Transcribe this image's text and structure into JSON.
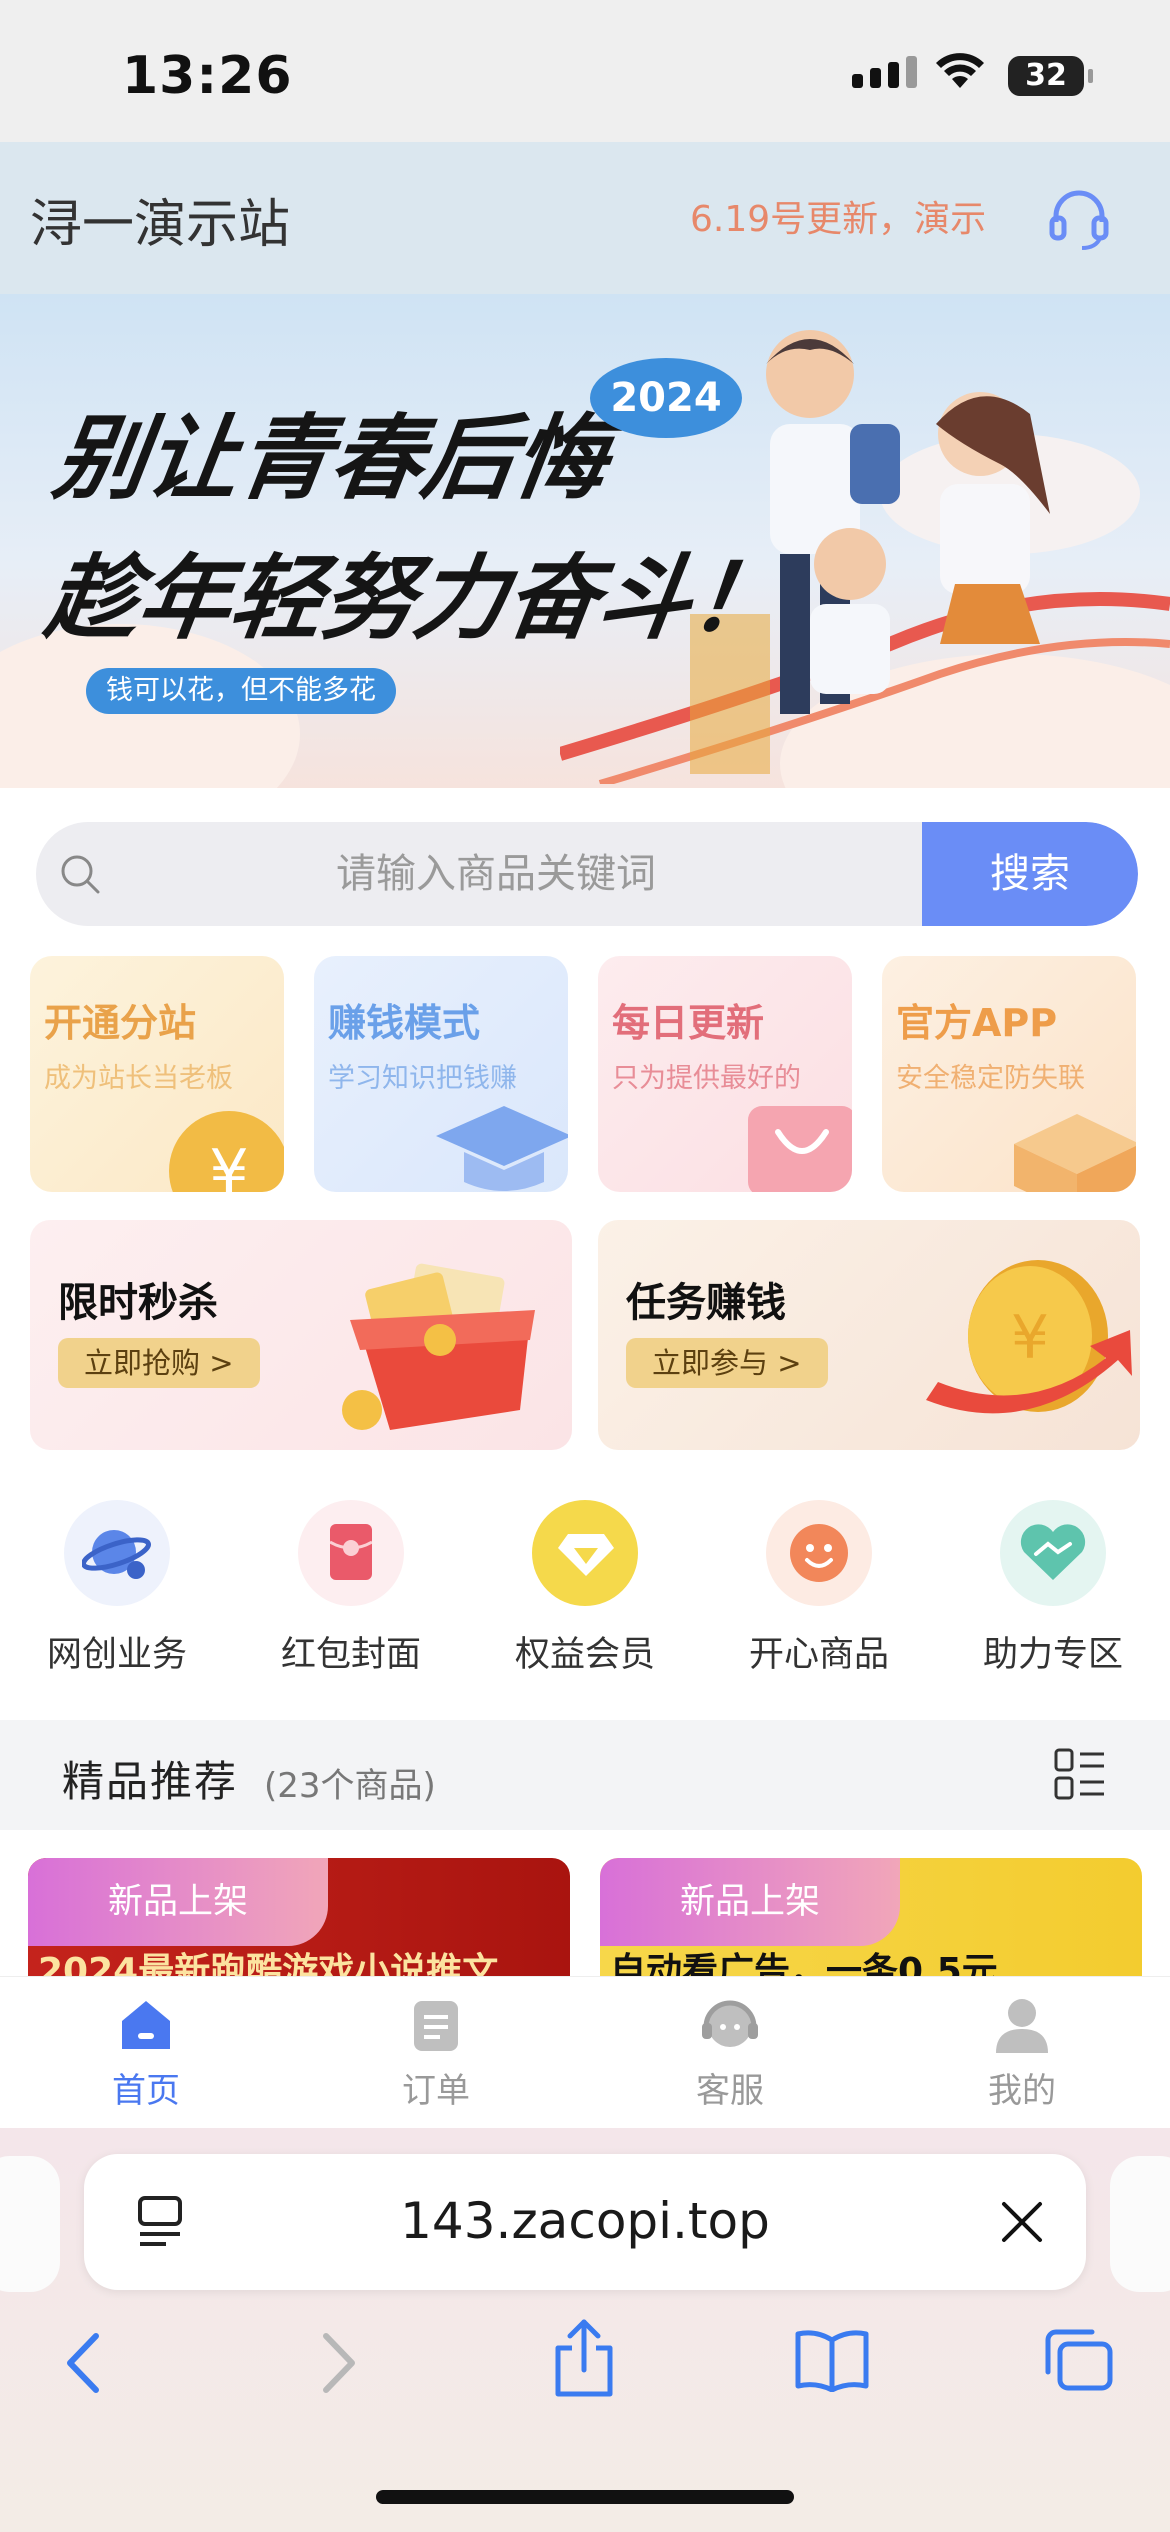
{
  "status": {
    "time": "13:26",
    "battery": "32"
  },
  "header": {
    "title": "浔一演示站",
    "notice": "6.19号更新，演示"
  },
  "banner": {
    "line1": "别让青春后悔",
    "line2": "趁年轻努力奋斗！",
    "year": "2024",
    "tagline": "钱可以花，但不能多花"
  },
  "search": {
    "placeholder": "请输入商品关键词",
    "button": "搜索"
  },
  "features": [
    {
      "title": "开通分站",
      "subtitle": "成为站长当老板",
      "color": "#e9a24a"
    },
    {
      "title": "赚钱模式",
      "subtitle": "学习知识把钱赚",
      "color": "#6aa0e9"
    },
    {
      "title": "每日更新",
      "subtitle": "只为提供最好的",
      "color": "#e26e7a"
    },
    {
      "title": "官方APP",
      "subtitle": "安全稳定防失联",
      "color": "#ee9d4a"
    }
  ],
  "promos": [
    {
      "title": "限时秒杀",
      "button": "立即抢购 >"
    },
    {
      "title": "任务赚钱",
      "button": "立即参与 >"
    }
  ],
  "quick": [
    {
      "label": "网创业务",
      "icon": "planet-icon"
    },
    {
      "label": "红包封面",
      "icon": "red-envelope-icon"
    },
    {
      "label": "权益会员",
      "icon": "diamond-icon"
    },
    {
      "label": "开心商品",
      "icon": "smile-icon"
    },
    {
      "label": "助力专区",
      "icon": "handshake-icon"
    }
  ],
  "recommend": {
    "title": "精品推荐",
    "count": "(23个商品)"
  },
  "products": [
    {
      "tag": "新品上架",
      "title": "2024最新跑酷游戏小说推文"
    },
    {
      "tag": "新品上架",
      "title": "自动看广告，一条0.5元"
    }
  ],
  "tabbar": [
    {
      "label": "首页",
      "icon": "home-icon",
      "active": true
    },
    {
      "label": "订单",
      "icon": "order-icon",
      "active": false
    },
    {
      "label": "客服",
      "icon": "headset-icon",
      "active": false
    },
    {
      "label": "我的",
      "icon": "user-icon",
      "active": false
    }
  ],
  "browser": {
    "url": "143.zacopi.top"
  },
  "colors": {
    "accent": "#6a8df6",
    "active_tab": "#4a78f0",
    "notice": "#e7886a"
  }
}
